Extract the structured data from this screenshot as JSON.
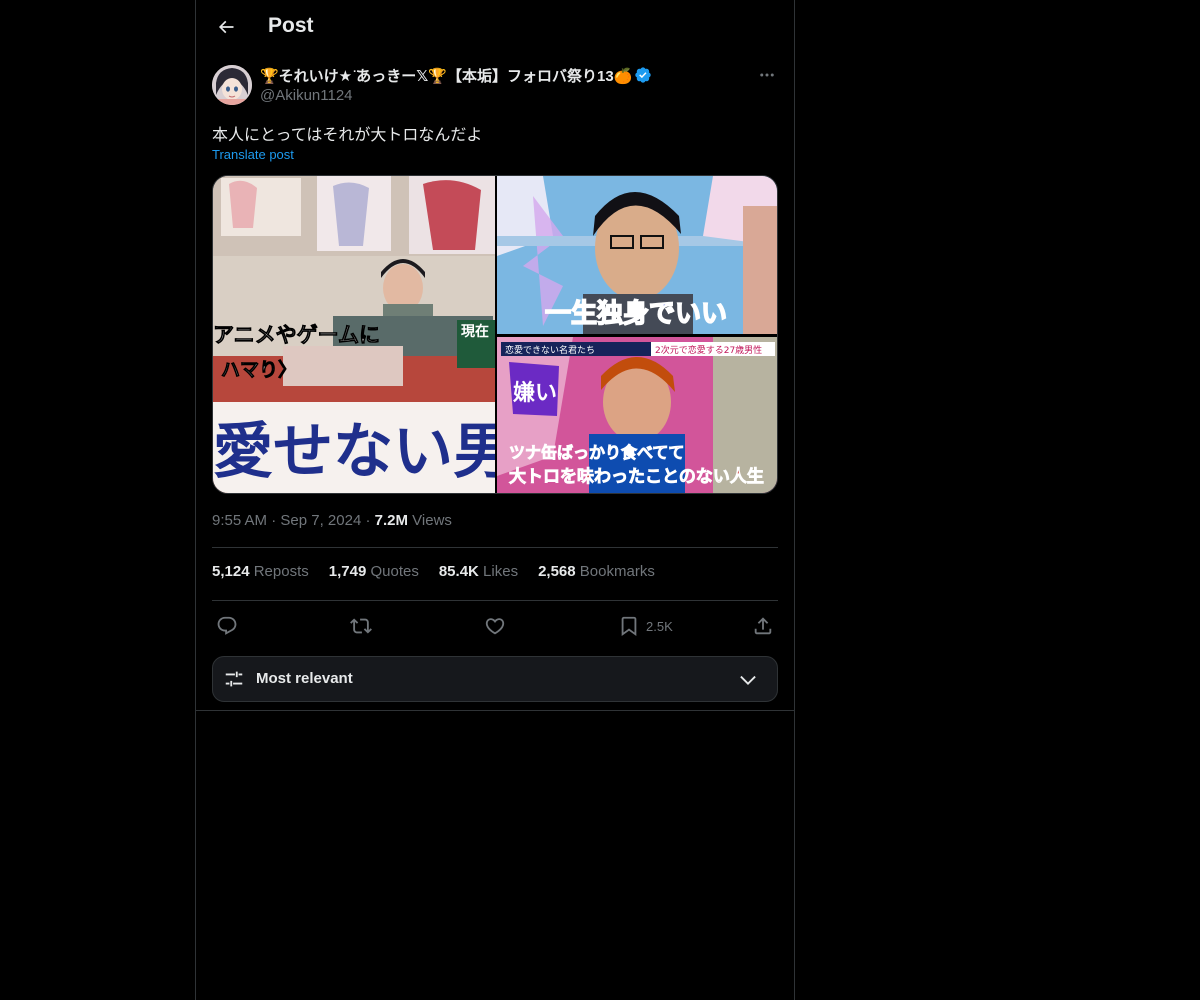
{
  "header": {
    "title": "Post"
  },
  "post": {
    "author": {
      "display_name": "🏆それいけ★ ̈あっきー𝕏🏆【本垢】フォロバ祭り13🍊",
      "handle": "@Akikun1124",
      "verified": true
    },
    "text": "本人にとってはそれが大トロなんだよ",
    "translate_label": "Translate post",
    "media": {
      "captions": {
        "panel1_line1": "アニメやゲームに",
        "panel1_line2": "ハマり〉",
        "panel1_big": "愛せない男",
        "panel1_badge": "現在",
        "panel2_big": "一生独身でいい",
        "panel3_top_left": "恋愛できない名君たち",
        "panel3_top_right": "2次元で恋愛する27歳男性",
        "panel3_badge": "嫌い",
        "panel3_line1": "ツナ缶ばっかり食べてて",
        "panel3_line2": "大トロを味わったことのない人生"
      }
    },
    "meta": {
      "time": "9:55 AM",
      "date": "Sep 7, 2024",
      "views_count": "7.2M",
      "views_label": "Views"
    },
    "stats": {
      "reposts": {
        "count": "5,124",
        "label": "Reposts"
      },
      "quotes": {
        "count": "1,749",
        "label": "Quotes"
      },
      "likes": {
        "count": "85.4K",
        "label": "Likes"
      },
      "bookmarks": {
        "count": "2,568",
        "label": "Bookmarks"
      }
    },
    "actions": {
      "bookmark_count": "2.5K"
    },
    "sort": {
      "label": "Most relevant"
    }
  },
  "colors": {
    "accent": "#1d9bf0",
    "background": "#000000",
    "border": "#2f3336",
    "muted": "#71767b"
  },
  "icons": [
    "back-arrow-icon",
    "verified-badge-icon",
    "more-icon",
    "reply-icon",
    "repost-icon",
    "like-icon",
    "bookmark-icon",
    "share-icon",
    "sliders-icon",
    "chevron-down-icon"
  ]
}
